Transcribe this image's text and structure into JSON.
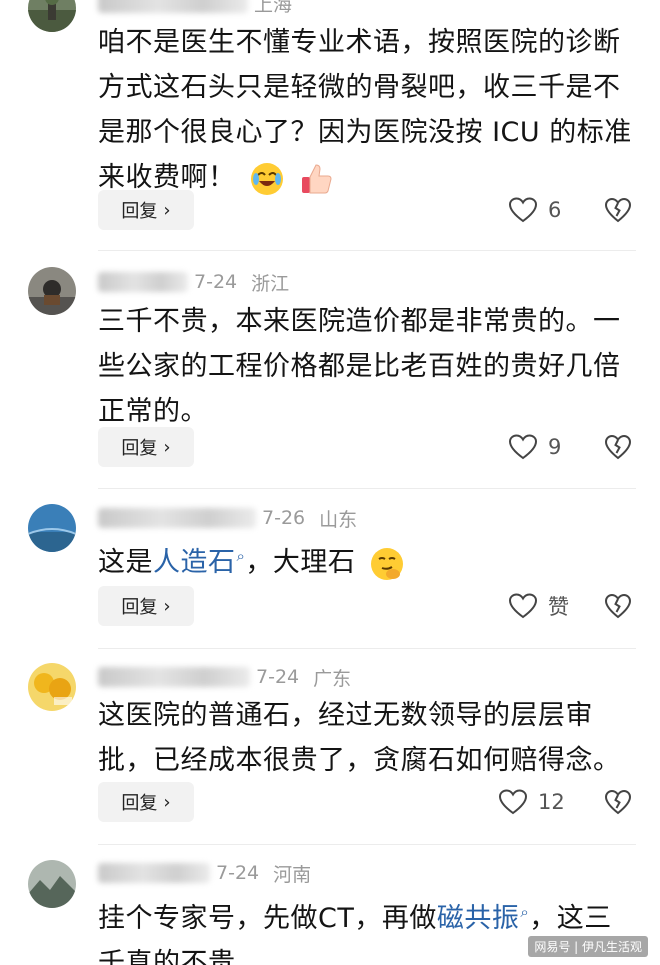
{
  "comments": [
    {
      "user": "",
      "date": "",
      "location": "上海",
      "text": "咱不是医生不懂专业术语，按照医院的诊断方式这石头只是轻微的骨裂吧，收三千是不是那个很良心了？因为医院没按 ICU 的标准来收费啊！",
      "reply_label": "回复",
      "like_count": "6"
    },
    {
      "user": "",
      "date": "7-24",
      "location": "浙江",
      "text": "三千不贵，本来医院造价都是非常贵的。一些公家的工程价格都是比老百姓的贵好几倍正常的。",
      "reply_label": "回复",
      "like_count": "9"
    },
    {
      "user": "",
      "date": "7-26",
      "location": "山东",
      "text_before": "这是",
      "keyword": "人造石",
      "text_after": "，大理石",
      "reply_label": "回复",
      "like_count": "赞"
    },
    {
      "user": "",
      "date": "7-24",
      "location": "广东",
      "text": "这医院的普通石，经过无数领导的层层审批，已经成本很贵了，贪腐石如何赔得念。",
      "reply_label": "回复",
      "like_count": "12"
    },
    {
      "user": "",
      "date": "7-24",
      "location": "河南",
      "text_before": "挂个专家号，先做CT，再做",
      "keyword": "磁共振",
      "text_after": "，这三千真的不贵"
    }
  ],
  "reply_chevron": "›",
  "watermark": "网易号 | 伊凡生活观",
  "colors": {
    "keyword": "#2a63a8",
    "meta": "#9a9a9a",
    "reply_bg": "#f2f2f2"
  },
  "icons": {
    "like": "heart-outline-icon",
    "dislike": "broken-heart-icon",
    "search": "magnifier-icon"
  }
}
